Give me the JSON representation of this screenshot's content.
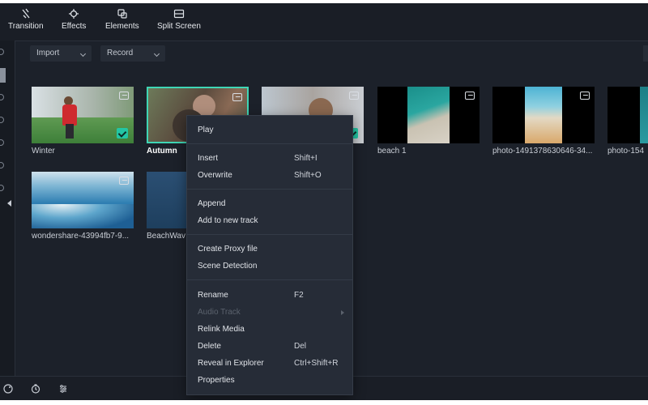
{
  "toolbar": {
    "items": [
      {
        "label": "Transition",
        "icon": "transition-icon"
      },
      {
        "label": "Effects",
        "icon": "effects-icon"
      },
      {
        "label": "Elements",
        "icon": "elements-icon"
      },
      {
        "label": "Split Screen",
        "icon": "split-screen-icon"
      }
    ]
  },
  "subtoolbar": {
    "import_label": "Import",
    "record_label": "Record"
  },
  "media": [
    {
      "label": "Winter",
      "checked": true
    },
    {
      "label": "Autumn",
      "selected": true
    },
    {
      "label": ""
    },
    {
      "label": "beach 1"
    },
    {
      "label": "photo-1491378630646-34..."
    },
    {
      "label": "photo-154"
    },
    {
      "label": "wondershare-43994fb7-9..."
    },
    {
      "label": "BeachWav"
    }
  ],
  "context_menu": {
    "items": [
      {
        "label": "Play",
        "shortcut": ""
      },
      {
        "label": "Insert",
        "shortcut": "Shift+I"
      },
      {
        "label": "Overwrite",
        "shortcut": "Shift+O"
      },
      {
        "label": "Append",
        "shortcut": ""
      },
      {
        "label": "Add to new track",
        "shortcut": ""
      },
      {
        "label": "Create Proxy file",
        "shortcut": ""
      },
      {
        "label": "Scene Detection",
        "shortcut": ""
      },
      {
        "label": "Rename",
        "shortcut": "F2"
      },
      {
        "label": "Audio Track",
        "shortcut": "",
        "disabled": true,
        "submenu": true
      },
      {
        "label": "Relink Media",
        "shortcut": ""
      },
      {
        "label": "Delete",
        "shortcut": "Del"
      },
      {
        "label": "Reveal in Explorer",
        "shortcut": "Ctrl+Shift+R"
      },
      {
        "label": "Properties",
        "shortcut": ""
      }
    ]
  },
  "colors": {
    "accent": "#3fd6b5",
    "panel_bg": "#1c212a",
    "menu_bg": "#262c37"
  },
  "bottombar": {
    "icons": [
      "palette-icon",
      "timer-icon",
      "adjust-icon"
    ]
  }
}
